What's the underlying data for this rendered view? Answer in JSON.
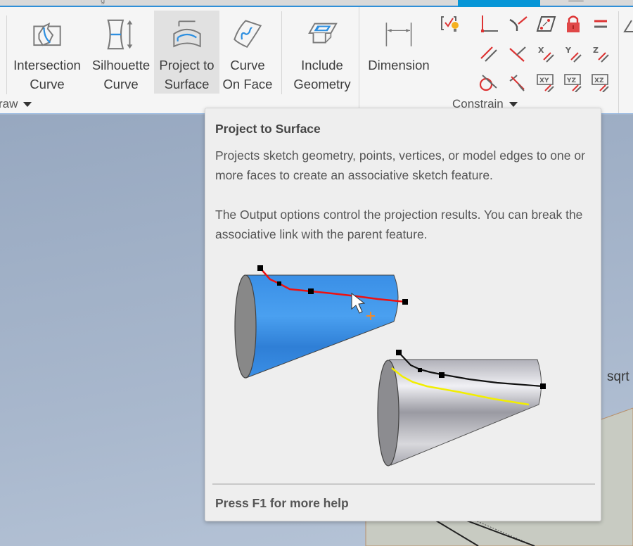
{
  "tabstrip": {
    "active_tab_color": "#0696d7"
  },
  "ribbon": {
    "draw_panel": {
      "label": "raw",
      "tools": [
        {
          "id": "intersection-curve",
          "line1": "Intersection",
          "line2": "Curve",
          "icon": "intersection-curve-icon"
        },
        {
          "id": "silhouette-curve",
          "line1": "Silhouette",
          "line2": "Curve",
          "icon": "silhouette-curve-icon"
        },
        {
          "id": "project-to-surface",
          "line1": "Project to",
          "line2": "Surface",
          "icon": "project-to-surface-icon",
          "highlighted": true
        },
        {
          "id": "curve-on-face",
          "line1": "Curve",
          "line2": "On Face",
          "icon": "curve-on-face-icon"
        },
        {
          "id": "include-geometry",
          "line1": "Include",
          "line2": "Geometry",
          "icon": "include-geometry-icon"
        }
      ]
    },
    "constrain_panel": {
      "label": "Constrain",
      "dimension": {
        "label": "Dimension",
        "icon": "dimension-icon"
      },
      "icons": [
        "auto-dimension-icon",
        "coincident-icon",
        "collinear-icon",
        "tangent-icon",
        "fix-icon",
        "equal-icon",
        "parallel-icon",
        "perpendicular-icon",
        "horizontal-x-icon",
        "vertical-y-icon",
        "z-parallel-icon",
        "tangent-circle-icon",
        "smooth-icon",
        "xy-plane-icon",
        "yz-plane-icon",
        "xz-plane-icon"
      ]
    }
  },
  "viewport": {
    "label": "sqrt"
  },
  "tooltip": {
    "title": "Project to Surface",
    "paragraph1": "Projects sketch geometry, points, vertices, or model edges to one or more faces to create an associative sketch feature.",
    "paragraph2": "The Output options control the projection results. You can break the associative link with the parent feature.",
    "help": "Press F1 for more help",
    "colors": {
      "blue_cone": "#3a8fe0",
      "red_curve": "#ee1111",
      "yellow_curve": "#f2ee00"
    }
  }
}
